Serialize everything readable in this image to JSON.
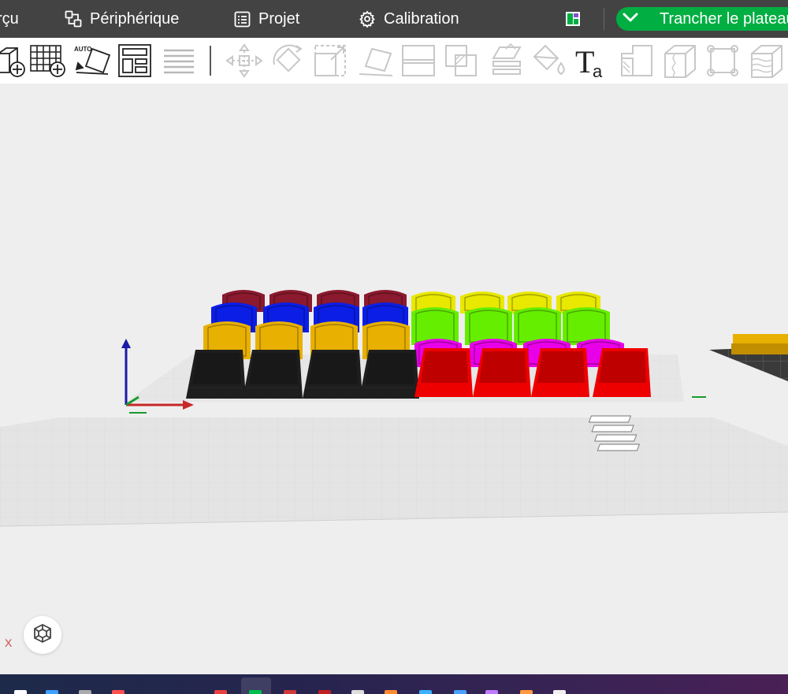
{
  "app": {
    "accent_color": "#00ae42",
    "menu_bar_color": "#434343"
  },
  "menu": {
    "preview_label": "rçu",
    "device_label": "Périphérique",
    "project_label": "Projet",
    "calibration_label": "Calibration"
  },
  "slice": {
    "button_label": "Trancher le plateau",
    "dropdown_icon": "chevron-down-icon"
  },
  "toolbar": {
    "tools": [
      "add-object-icon",
      "add-plate-icon",
      "auto-orient-icon",
      "arrange-icon",
      "layers-icon",
      "move-icon",
      "rotate-icon",
      "scale-icon",
      "lay-on-face-icon",
      "cut-icon",
      "boolean-icon",
      "support-paint-icon",
      "color-paint-icon",
      "text-icon",
      "seam-icon",
      "fuzzy-skin-icon",
      "measure-icon",
      "variable-layer-icon"
    ],
    "auto_label": "AUTO",
    "text_tool_letters": "Ta"
  },
  "viewport": {
    "axis_label_x": "X",
    "view_cube_icon": "view-cube-icon",
    "model_colors": [
      "#8b1a2e",
      "#0a1ee6",
      "#e8b000",
      "#1e1e1e",
      "#e8e800",
      "#66ee00",
      "#e800e8",
      "#ee0000"
    ]
  },
  "taskbar": {
    "app_icons": [
      "start-icon",
      "search-icon",
      "files-icon",
      "browser-icon",
      "app-icon",
      "bambu-studio-icon",
      "app-icon",
      "app-icon",
      "app-icon",
      "app-icon",
      "app-icon",
      "app-icon",
      "app-icon",
      "app-icon",
      "app-icon"
    ]
  }
}
